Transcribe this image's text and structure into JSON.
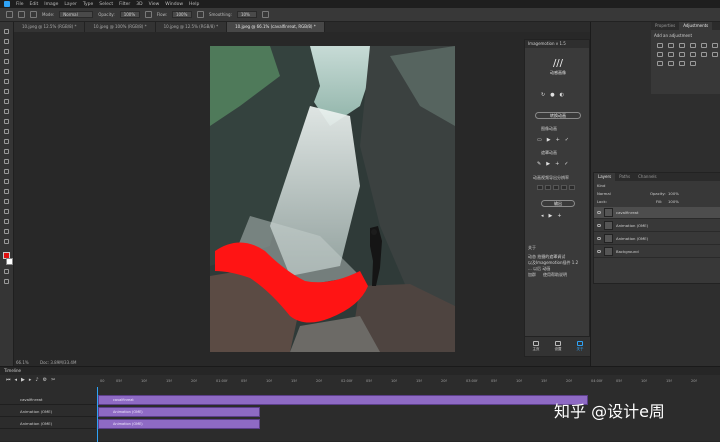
{
  "menu": {
    "items": [
      "File",
      "Edit",
      "Image",
      "Layer",
      "Type",
      "Select",
      "Filter",
      "3D",
      "View",
      "Window",
      "Help"
    ]
  },
  "options": {
    "mode_label": "Mode:",
    "mode_value": "Normal",
    "opacity_label": "Opacity:",
    "opacity_value": "100%",
    "flow_label": "Flow:",
    "flow_value": "100%",
    "smoothing_label": "Smoothing:",
    "smoothing_value": "10%"
  },
  "doc_tabs": [
    {
      "label": "10.jpeg @ 12.5% (RGB/8) *",
      "active": false
    },
    {
      "label": "10.jpeg @ 100% (RGB/8) *",
      "active": false
    },
    {
      "label": "10.jpeg @ 12.5% (RGB/8) *",
      "active": false
    },
    {
      "label": "10.jpeg @ 66.1% (cavalfinreat, RGB/8) *",
      "active": true
    }
  ],
  "status": {
    "zoom": "66.1%",
    "doc": "Doc: 3.89M/33.4M"
  },
  "extension": {
    "title": "Imagemotion v 1.5",
    "brand": "动感画像",
    "main_button": "转换动画",
    "section1_label": "图像动画",
    "section2_label": "遮罩动画",
    "section3_label": "动画视频导出分辨率",
    "export_button": "输出",
    "about_title": "关于",
    "about_text1": "动态 拍摄的遮罩调试",
    "about_text2": "以及Imagemotion插件 1.2",
    "about_text3": "... 以后 动画",
    "about_link1": "加群",
    "about_link2": "使用帮助说明",
    "footer": [
      {
        "label": "主页",
        "icon": "monitor-icon",
        "active": false
      },
      {
        "label": "设置",
        "icon": "gear-icon",
        "active": false
      },
      {
        "label": "关于",
        "icon": "info-icon",
        "active": true
      }
    ]
  },
  "adjustments": {
    "tabs": [
      "Properties",
      "Adjustments"
    ],
    "active_tab": "Adjustments",
    "title": "Add an adjustment"
  },
  "layers": {
    "tabs": [
      "Layers",
      "Paths",
      "Channels"
    ],
    "active_tab": "Layers",
    "kind_label": "Kind",
    "blend": "Normal",
    "opacity_label": "Opacity:",
    "opacity_value": "100%",
    "lock_label": "Lock:",
    "fill_label": "Fill:",
    "fill_value": "100%",
    "rows": [
      {
        "name": "cavalfinreat",
        "selected": true
      },
      {
        "name": "Animation (OME)",
        "selected": false
      },
      {
        "name": "Animation (OME)",
        "selected": false
      },
      {
        "name": "Background",
        "selected": false
      }
    ]
  },
  "timeline": {
    "title": "Timeline",
    "ticks": [
      "00",
      "05f",
      "10f",
      "15f",
      "20f",
      "01:00f",
      "05f",
      "10f",
      "15f",
      "20f",
      "02:00f",
      "05f",
      "10f",
      "15f",
      "20f",
      "03:00f",
      "05f",
      "10f",
      "15f",
      "20f",
      "04:00f",
      "05f",
      "10f",
      "15f",
      "20f"
    ],
    "tracks": [
      {
        "label": "cavalfinreat",
        "clip": "cavalfinreat"
      },
      {
        "label": "Animation (OME)",
        "clip": "Animation (OME)"
      },
      {
        "label": "Animation (OME)",
        "clip": "Animation (OME)"
      }
    ]
  },
  "watermark": "知乎 @设计e周",
  "colors": {
    "foreground": "#e01010",
    "background": "#ffffff",
    "accent": "#2fa3f7",
    "clip": "#8e6ac4"
  }
}
